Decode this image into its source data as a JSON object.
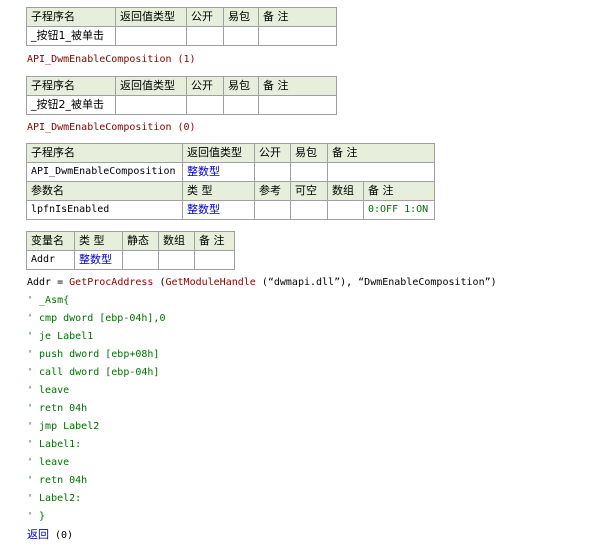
{
  "sub1": {
    "headers": [
      "子程序名",
      "返回值类型",
      "公开",
      "易包",
      "备 注"
    ],
    "name": "_按钮1_被单击"
  },
  "call1": "API_DwmEnableComposition (1)",
  "sub2": {
    "headers": [
      "子程序名",
      "返回值类型",
      "公开",
      "易包",
      "备 注"
    ],
    "name": "_按钮2_被单击"
  },
  "call2": "API_DwmEnableComposition (0)",
  "sub3": {
    "headers": [
      "子程序名",
      "返回值类型",
      "公开",
      "易包",
      "备 注"
    ],
    "name": "API_DwmEnableComposition",
    "return_type": "整数型",
    "param_headers": [
      "参数名",
      "类 型",
      "参考",
      "可空",
      "数组",
      "备 注"
    ],
    "param": {
      "name": "lpfnIsEnabled",
      "type": "整数型",
      "note": "0:OFF 1:ON"
    }
  },
  "locals": {
    "headers": [
      "变量名",
      "类 型",
      "静态",
      "数组",
      "备 注"
    ],
    "var": {
      "name": "Addr",
      "type": "整数型"
    }
  },
  "code": {
    "assign": {
      "left": "Addr = ",
      "func1": "GetProcAddress",
      "open1": " (",
      "func2": "GetModuleHandle",
      "args": " (“dwmapi.dll”), “DwmEnableComposition”)"
    },
    "asm_lines": [
      "' _Asm{",
      "' cmp dword [ebp-04h],0",
      "' je Label1",
      "' push dword [ebp+08h]",
      "' call dword [ebp-04h]",
      "' leave",
      "' retn 04h",
      "' jmp Label2",
      "' Label1:",
      "' leave",
      "' retn 04h",
      "' Label2:",
      "' }"
    ],
    "return": {
      "keyword": "返回",
      "value": " (0)"
    }
  },
  "colors": {
    "header_bg": "#e7eedb",
    "grid": "#a0a0a0",
    "keyword_blue": "#0000cc",
    "comment_green": "#007000",
    "call_darkred": "#8b0000"
  }
}
